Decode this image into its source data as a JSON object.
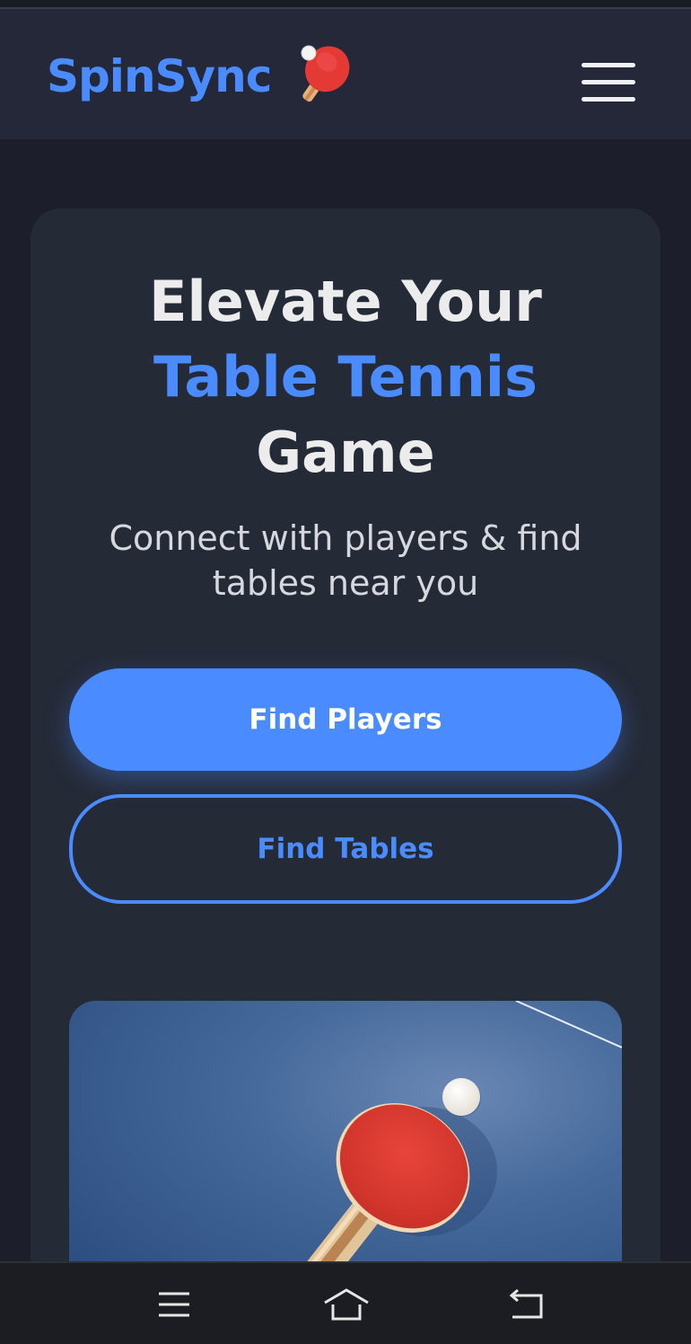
{
  "header": {
    "brand_name": "SpinSync",
    "brand_icon": "ping-pong-paddle-icon",
    "menu_icon": "hamburger-menu-icon"
  },
  "hero": {
    "title_line1": "Elevate Your",
    "title_accent": "Table Tennis",
    "title_line3": "Game",
    "subtitle": "Connect with players & find tables near you",
    "primary_button": "Find Players",
    "secondary_button": "Find Tables",
    "image": "ping-pong-paddle-and-ball-on-table-photo"
  },
  "colors": {
    "accent": "#4a8cff",
    "background": "#1c1f2b",
    "card": "#252a37",
    "header": "#242838"
  },
  "system_nav": {
    "items": [
      "recent-apps-icon",
      "home-icon",
      "back-icon"
    ]
  }
}
